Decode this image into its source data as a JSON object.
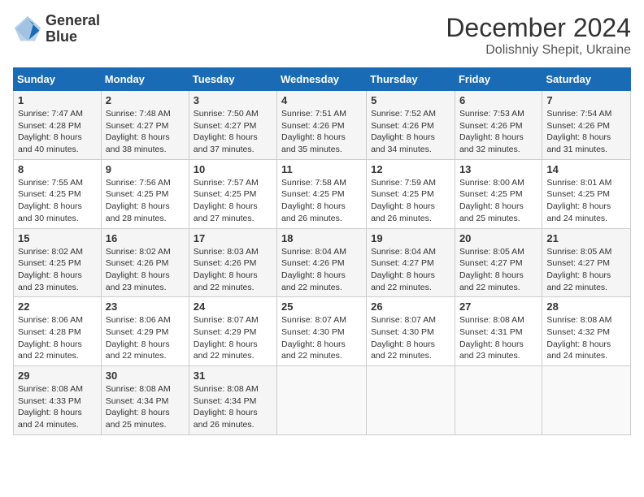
{
  "header": {
    "logo_line1": "General",
    "logo_line2": "Blue",
    "title": "December 2024",
    "subtitle": "Dolishniy Shepit, Ukraine"
  },
  "calendar": {
    "days_of_week": [
      "Sunday",
      "Monday",
      "Tuesday",
      "Wednesday",
      "Thursday",
      "Friday",
      "Saturday"
    ],
    "weeks": [
      [
        {
          "day": "1",
          "sunrise": "7:47 AM",
          "sunset": "4:28 PM",
          "daylight": "8 hours and 40 minutes."
        },
        {
          "day": "2",
          "sunrise": "7:48 AM",
          "sunset": "4:27 PM",
          "daylight": "8 hours and 38 minutes."
        },
        {
          "day": "3",
          "sunrise": "7:50 AM",
          "sunset": "4:27 PM",
          "daylight": "8 hours and 37 minutes."
        },
        {
          "day": "4",
          "sunrise": "7:51 AM",
          "sunset": "4:26 PM",
          "daylight": "8 hours and 35 minutes."
        },
        {
          "day": "5",
          "sunrise": "7:52 AM",
          "sunset": "4:26 PM",
          "daylight": "8 hours and 34 minutes."
        },
        {
          "day": "6",
          "sunrise": "7:53 AM",
          "sunset": "4:26 PM",
          "daylight": "8 hours and 32 minutes."
        },
        {
          "day": "7",
          "sunrise": "7:54 AM",
          "sunset": "4:26 PM",
          "daylight": "8 hours and 31 minutes."
        }
      ],
      [
        {
          "day": "8",
          "sunrise": "7:55 AM",
          "sunset": "4:25 PM",
          "daylight": "8 hours and 30 minutes."
        },
        {
          "day": "9",
          "sunrise": "7:56 AM",
          "sunset": "4:25 PM",
          "daylight": "8 hours and 28 minutes."
        },
        {
          "day": "10",
          "sunrise": "7:57 AM",
          "sunset": "4:25 PM",
          "daylight": "8 hours and 27 minutes."
        },
        {
          "day": "11",
          "sunrise": "7:58 AM",
          "sunset": "4:25 PM",
          "daylight": "8 hours and 26 minutes."
        },
        {
          "day": "12",
          "sunrise": "7:59 AM",
          "sunset": "4:25 PM",
          "daylight": "8 hours and 26 minutes."
        },
        {
          "day": "13",
          "sunrise": "8:00 AM",
          "sunset": "4:25 PM",
          "daylight": "8 hours and 25 minutes."
        },
        {
          "day": "14",
          "sunrise": "8:01 AM",
          "sunset": "4:25 PM",
          "daylight": "8 hours and 24 minutes."
        }
      ],
      [
        {
          "day": "15",
          "sunrise": "8:02 AM",
          "sunset": "4:25 PM",
          "daylight": "8 hours and 23 minutes."
        },
        {
          "day": "16",
          "sunrise": "8:02 AM",
          "sunset": "4:26 PM",
          "daylight": "8 hours and 23 minutes."
        },
        {
          "day": "17",
          "sunrise": "8:03 AM",
          "sunset": "4:26 PM",
          "daylight": "8 hours and 22 minutes."
        },
        {
          "day": "18",
          "sunrise": "8:04 AM",
          "sunset": "4:26 PM",
          "daylight": "8 hours and 22 minutes."
        },
        {
          "day": "19",
          "sunrise": "8:04 AM",
          "sunset": "4:27 PM",
          "daylight": "8 hours and 22 minutes."
        },
        {
          "day": "20",
          "sunrise": "8:05 AM",
          "sunset": "4:27 PM",
          "daylight": "8 hours and 22 minutes."
        },
        {
          "day": "21",
          "sunrise": "8:05 AM",
          "sunset": "4:27 PM",
          "daylight": "8 hours and 22 minutes."
        }
      ],
      [
        {
          "day": "22",
          "sunrise": "8:06 AM",
          "sunset": "4:28 PM",
          "daylight": "8 hours and 22 minutes."
        },
        {
          "day": "23",
          "sunrise": "8:06 AM",
          "sunset": "4:29 PM",
          "daylight": "8 hours and 22 minutes."
        },
        {
          "day": "24",
          "sunrise": "8:07 AM",
          "sunset": "4:29 PM",
          "daylight": "8 hours and 22 minutes."
        },
        {
          "day": "25",
          "sunrise": "8:07 AM",
          "sunset": "4:30 PM",
          "daylight": "8 hours and 22 minutes."
        },
        {
          "day": "26",
          "sunrise": "8:07 AM",
          "sunset": "4:30 PM",
          "daylight": "8 hours and 22 minutes."
        },
        {
          "day": "27",
          "sunrise": "8:08 AM",
          "sunset": "4:31 PM",
          "daylight": "8 hours and 23 minutes."
        },
        {
          "day": "28",
          "sunrise": "8:08 AM",
          "sunset": "4:32 PM",
          "daylight": "8 hours and 24 minutes."
        }
      ],
      [
        {
          "day": "29",
          "sunrise": "8:08 AM",
          "sunset": "4:33 PM",
          "daylight": "8 hours and 24 minutes."
        },
        {
          "day": "30",
          "sunrise": "8:08 AM",
          "sunset": "4:34 PM",
          "daylight": "8 hours and 25 minutes."
        },
        {
          "day": "31",
          "sunrise": "8:08 AM",
          "sunset": "4:34 PM",
          "daylight": "8 hours and 26 minutes."
        },
        null,
        null,
        null,
        null
      ]
    ]
  }
}
